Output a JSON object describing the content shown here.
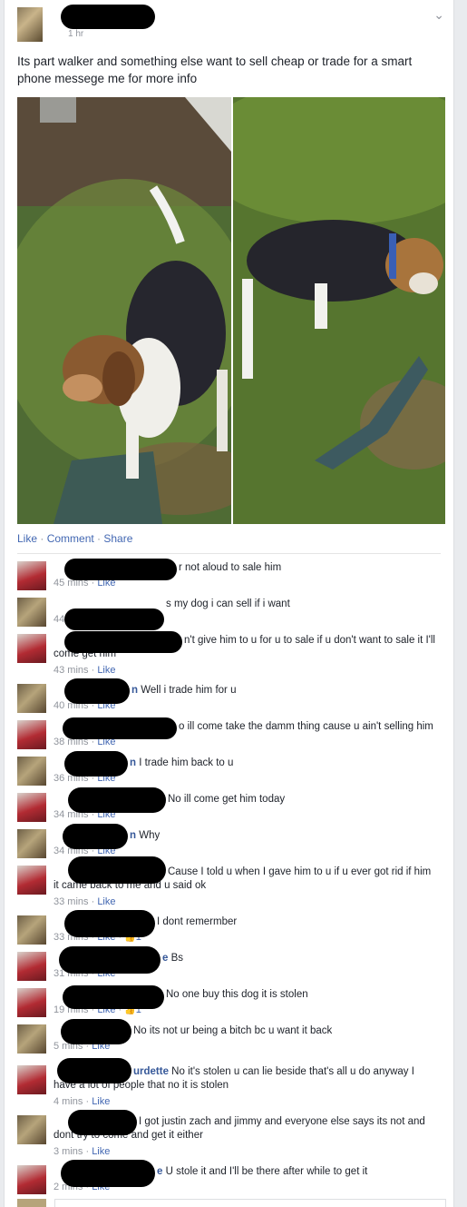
{
  "post": {
    "meta": "1 hr",
    "text": "Its part walker and something else want to sell cheap or trade for a smart phone messege me for more info",
    "actions": {
      "like": "Like",
      "comment": "Comment",
      "share": "Share",
      "sep": " · "
    }
  },
  "comments": [
    {
      "avatar": "red",
      "text": "r not aloud to sale him",
      "time": "45 mins",
      "like": "Like"
    },
    {
      "avatar": "tan",
      "text": "s my dog i can sell if i want",
      "time": "44 mins",
      "like": "Like"
    },
    {
      "avatar": "red",
      "text": "n't give him to u for u to sale if u don't want to sale it I'll come get him",
      "time": "43 mins",
      "like": "Like"
    },
    {
      "avatar": "tan",
      "name": "n",
      "text": " Well i trade him for u",
      "time": "40 mins",
      "like": "Like"
    },
    {
      "avatar": "red",
      "text": "o ill come take the damm thing cause u ain't selling him",
      "time": "38 mins",
      "like": "Like"
    },
    {
      "avatar": "tan",
      "name": "n",
      "text": " I trade him back to u",
      "time": "36 mins",
      "like": "Like"
    },
    {
      "avatar": "red",
      "text": "No ill come get him today",
      "time": "34 mins",
      "like": "Like"
    },
    {
      "avatar": "tan",
      "name": "n",
      "text": " Why",
      "time": "34 mins",
      "like": "Like"
    },
    {
      "avatar": "red",
      "text": "Cause I told u when I gave him to u if u ever got rid if him it came back to me and u said ok",
      "time": "33 mins",
      "like": "Like"
    },
    {
      "avatar": "tan",
      "text": "I dont remermber",
      "time": "33 mins",
      "like": "Like",
      "likes": "1"
    },
    {
      "avatar": "red",
      "name": "e",
      "text": " Bs",
      "time": "31 mins",
      "like": "Like"
    },
    {
      "avatar": "red",
      "text": "No one buy this dog it is stolen",
      "time": "19 mins",
      "like": "Like",
      "likes": "1"
    },
    {
      "avatar": "tan",
      "text": "No its not ur being a bitch bc u want it back",
      "time": "5 mins",
      "like": "Like"
    },
    {
      "avatar": "red",
      "name": "urdette",
      "text": " No it's stolen u can lie beside that's all u do anyway I have a lot of people that no it is stolen",
      "time": "4 mins",
      "like": "Like"
    },
    {
      "avatar": "tan",
      "text": "I got justin zach and jimmy and everyone else says its not and dont try to come and get it either",
      "time": "3 mins",
      "like": "Like"
    },
    {
      "avatar": "red",
      "name": "e",
      "text": " U stole it and I'll be there after while to get it",
      "time": "2 mins",
      "like": "Like"
    }
  ]
}
